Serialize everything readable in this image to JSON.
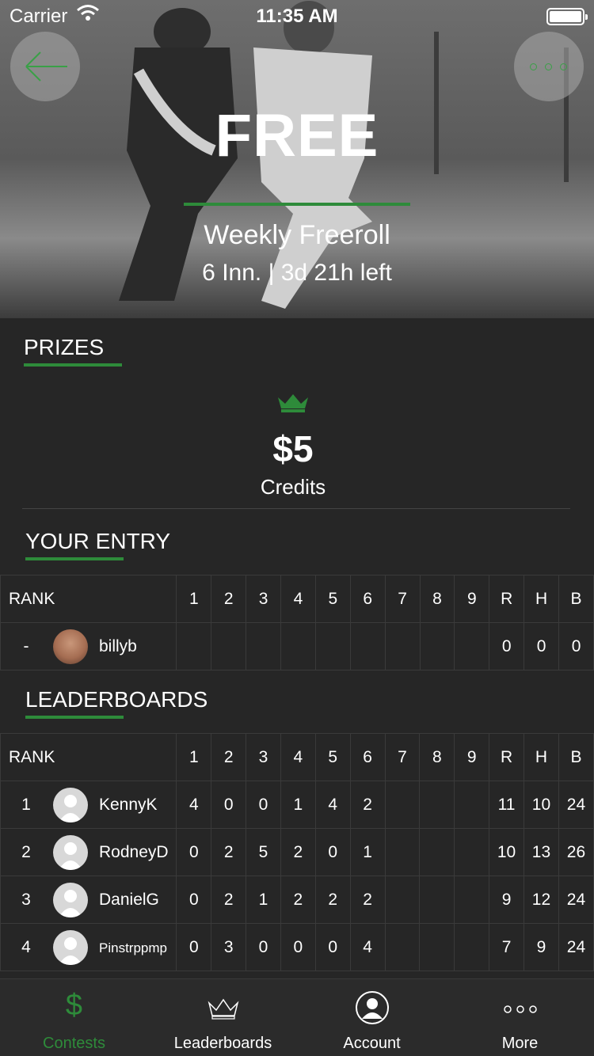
{
  "status_bar": {
    "carrier": "Carrier",
    "time": "11:35 AM"
  },
  "hero": {
    "title": "FREE",
    "subtitle": "Weekly Freeroll",
    "meta": "6 Inn. | 3d 21h left",
    "back_icon": "arrow-left-icon",
    "more_icon": "ellipsis-icon"
  },
  "prizes": {
    "heading": "PRIZES",
    "amount": "$5",
    "label": "Credits",
    "icon": "crown-icon"
  },
  "your_entry": {
    "heading": "YOUR ENTRY",
    "header": {
      "rank": "RANK",
      "cols": [
        "1",
        "2",
        "3",
        "4",
        "5",
        "6",
        "7",
        "8",
        "9",
        "R",
        "H",
        "B"
      ]
    },
    "row": {
      "rank": "-",
      "name": "billyb",
      "cells": [
        "",
        "",
        "",
        "",
        "",
        "",
        "",
        "",
        "",
        "0",
        "0",
        "0"
      ]
    }
  },
  "leaderboards": {
    "heading": "LEADERBOARDS",
    "header": {
      "rank": "RANK",
      "cols": [
        "1",
        "2",
        "3",
        "4",
        "5",
        "6",
        "7",
        "8",
        "9",
        "R",
        "H",
        "B"
      ]
    },
    "rows": [
      {
        "rank": "1",
        "name": "KennyK",
        "cells": [
          "4",
          "0",
          "0",
          "1",
          "4",
          "2",
          "",
          "",
          "",
          "11",
          "10",
          "24"
        ]
      },
      {
        "rank": "2",
        "name": "RodneyD",
        "cells": [
          "0",
          "2",
          "5",
          "2",
          "0",
          "1",
          "",
          "",
          "",
          "10",
          "13",
          "26"
        ]
      },
      {
        "rank": "3",
        "name": "DanielG",
        "cells": [
          "0",
          "2",
          "1",
          "2",
          "2",
          "2",
          "",
          "",
          "",
          "9",
          "12",
          "24"
        ]
      },
      {
        "rank": "4",
        "name": "Pinstrppmp",
        "cells": [
          "0",
          "3",
          "0",
          "0",
          "0",
          "4",
          "",
          "",
          "",
          "7",
          "9",
          "24"
        ]
      }
    ]
  },
  "tabbar": {
    "tabs": [
      {
        "label": "Contests",
        "icon": "dollar-icon",
        "active": true
      },
      {
        "label": "Leaderboards",
        "icon": "crown-icon",
        "active": false
      },
      {
        "label": "Account",
        "icon": "user-icon",
        "active": false
      },
      {
        "label": "More",
        "icon": "ellipsis-icon",
        "active": false
      }
    ]
  },
  "colors": {
    "accent": "#2e8b3a",
    "background": "#262626",
    "tab_active": "#2e8b3a"
  }
}
